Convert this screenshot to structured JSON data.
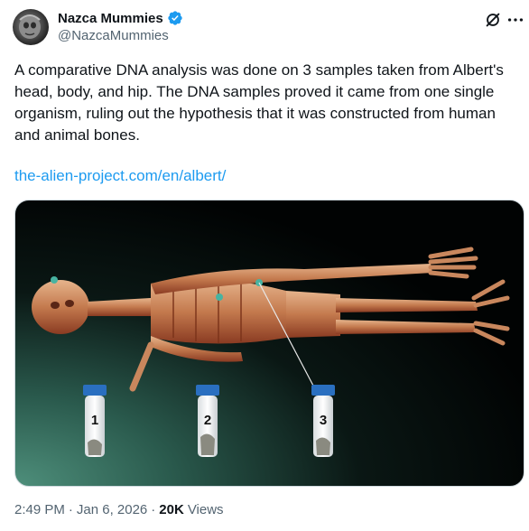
{
  "author": {
    "display_name": "Nazca Mummies",
    "handle": "@NazcaMummies",
    "verified": true,
    "avatar_icon": "mummy-avatar-icon"
  },
  "actions": {
    "grok_icon": "grok-slash-icon",
    "more_icon": "more-dots-icon"
  },
  "tweet": {
    "text": "A comparative DNA analysis was done on 3 samples taken from Albert's head, body, and hip. The DNA samples proved it came from one single organism, ruling out the hypothesis that it was constructed from human and animal bones.",
    "link": "the-alien-project.com/en/albert/"
  },
  "media": {
    "description_icon": "mummy-scan-image",
    "sample_labels": [
      "1",
      "2",
      "3"
    ]
  },
  "meta": {
    "time": "2:49 PM",
    "separator1": "·",
    "date": "Jan 6, 2026",
    "separator2": "·",
    "views_count": "20K",
    "views_label": "Views"
  },
  "colors": {
    "link": "#1d9bf0",
    "verified": "#1d9bf0",
    "secondary_text": "#536471"
  }
}
